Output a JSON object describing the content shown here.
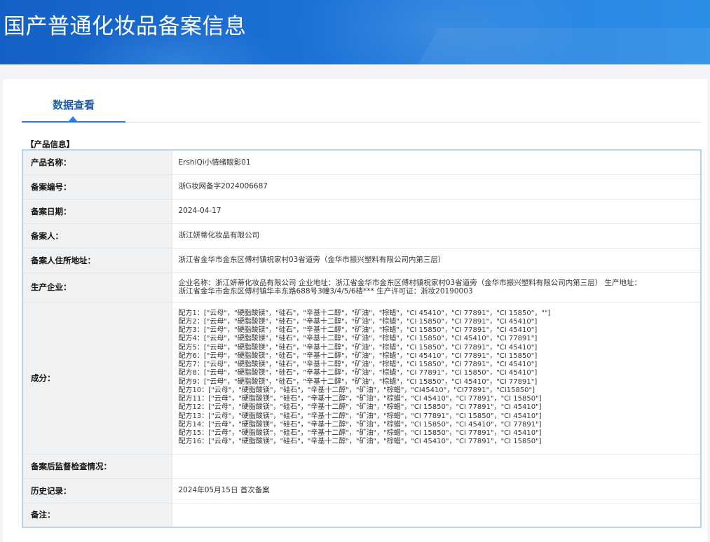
{
  "banner": {
    "title": "国产普通化妆品备案信息"
  },
  "tabs": [
    {
      "label": "数据查看"
    }
  ],
  "section": {
    "title": "【产品信息】"
  },
  "fields": {
    "product_name": {
      "label": "产品名称：",
      "value": "ErshiQi小情绪眼影01"
    },
    "record_no": {
      "label": "备案编号：",
      "value": "浙G妆网备字2024006687"
    },
    "record_date": {
      "label": "备案日期：",
      "value": "2024-04-17"
    },
    "registrant": {
      "label": "备案人：",
      "value": "浙江妍蒂化妆品有限公司"
    },
    "registrant_address": {
      "label": "备案人住所地址：",
      "value": "浙江省金华市金东区傅村镇祝家村03省道旁（金华市振兴塑料有限公司内第三层）"
    },
    "manufacturer": {
      "label": "生产企业：",
      "line1": "企业名称：浙江妍蒂化妆品有限公司 企业地址：浙江省金华市金东区傅村镇祝家村03省道旁（金华市振兴塑料有限公司内第三层） 生产地址：",
      "line2": "浙江省金华市金东区傅村镇华丰东路688号3幢3/4/5/6楼*** 生产许可证：浙妆20190003"
    },
    "ingredients": {
      "label": "成分：",
      "formulas": [
        "配方1：[\"云母\"，\"硬脂酸镁\"，\"硅石\"，\"辛基十二醇\"，\"矿油\"，\"棕蜡\"，\"CI 45410\"，\"CI 77891\"，\"CI 15850\"，\"\"]",
        "配方2：[\"云母\"，\"硬脂酸镁\"，\"硅石\"，\"辛基十二醇\"，\"矿油\"，\"棕蜡\"，\"CI 15850\"，\"CI 77891\"，\"CI 45410\"]",
        "配方3：[\"云母\"，\"硬脂酸镁\"，\"硅石\"，\"辛基十二醇\"，\"矿油\"，\"棕蜡\"，\"CI 15850\"，\"CI 77891\"，\"CI 45410\"]",
        "配方4：[\"云母\"，\"硬脂酸镁\"，\"硅石\"，\"辛基十二醇\"，\"矿油\"，\"棕蜡\"，\"CI 15850\"，\"CI 45410\"，\"CI 77891\"]",
        "配方5：[\"云母\"，\"硬脂酸镁\"，\"硅石\"，\"辛基十二醇\"，\"矿油\"，\"棕蜡\"，\"CI 15850\"，\"CI 77891\"，\"CI 45410\"]",
        "配方6：[\"云母\"，\"硬脂酸镁\"，\"硅石\"，\"辛基十二醇\"，\"矿油\"，\"棕蜡\"，\"CI 45410\"，\"CI 77891\"，\"CI 15850\"]",
        "配方7：[\"云母\"，\"硬脂酸镁\"，\"硅石\"，\"辛基十二醇\"，\"矿油\"，\"棕蜡\"，\"CI 15850\"，\"CI 77891\"，\"CI 45410\"]",
        "配方8：[\"云母\"，\"硬脂酸镁\"，\"硅石\"，\"辛基十二醇\"，\"矿油\"，\"棕蜡\"，\"CI 77891\"，\"CI 15850\"，\"CI 45410\"]",
        "配方9：[\"云母\"，\"硬脂酸镁\"，\"硅石\"，\"辛基十二醇\"，\"矿油\"，\"棕蜡\"，\"CI 15850\"，\"CI 45410\"，\"CI 77891\"]",
        "配方10：[\"云母\"，\"硬脂酸镁\"，\"硅石\"，\"辛基十二醇\"，\"矿油\"，\"棕蜡\"，\"CI45410\"，\"CI77891\"，\"CI15850\"]",
        "配方11：[\"云母\"，\"硬脂酸镁\"，\"硅石\"，\"辛基十二醇\"，\"矿油\"，\"棕蜡\"，\"CI 45410\"，\"CI 77891\"，\"CI 15850\"]",
        "配方12：[\"云母\"，\"硬脂酸镁\"，\"硅石\"，\"辛基十二醇\"，\"矿油\"，\"棕蜡\"，\"CI 15850\"，\"CI 77891\"，\"CI 45410\"]",
        "配方13：[\"云母\"，\"硬脂酸镁\"，\"硅石\"，\"辛基十二醇\"，\"矿油\"，\"棕蜡\"，\"CI 77891\"，\"CI 15850\"，\"CI 45410\"]",
        "配方14：[\"云母\"，\"硬脂酸镁\"，\"硅石\"，\"辛基十二醇\"，\"矿油\"，\"棕蜡\"，\"CI 15850\"，\"CI 45410\"，\"CI 77891\"]",
        "配方15：[\"云母\"，\"硬脂酸镁\"，\"硅石\"，\"辛基十二醇\"，\"矿油\"，\"棕蜡\"，\"CI 15850\"，\"CI 77891\"，\"CI 45410\"]",
        "配方16：[\"云母\"，\"硬脂酸镁\"，\"硅石\"，\"辛基十二醇\"，\"矿油\"，\"棕蜡\"，\"CI 45410\"，\"CI 77891\"，\"CI 15850\"]"
      ]
    },
    "post_inspection": {
      "label": "备案后监督检查情况：",
      "value": ""
    },
    "history": {
      "label": "历史记录：",
      "value": "2024年05月15日 首次备案"
    },
    "remarks": {
      "label": "备注：",
      "value": ""
    }
  }
}
